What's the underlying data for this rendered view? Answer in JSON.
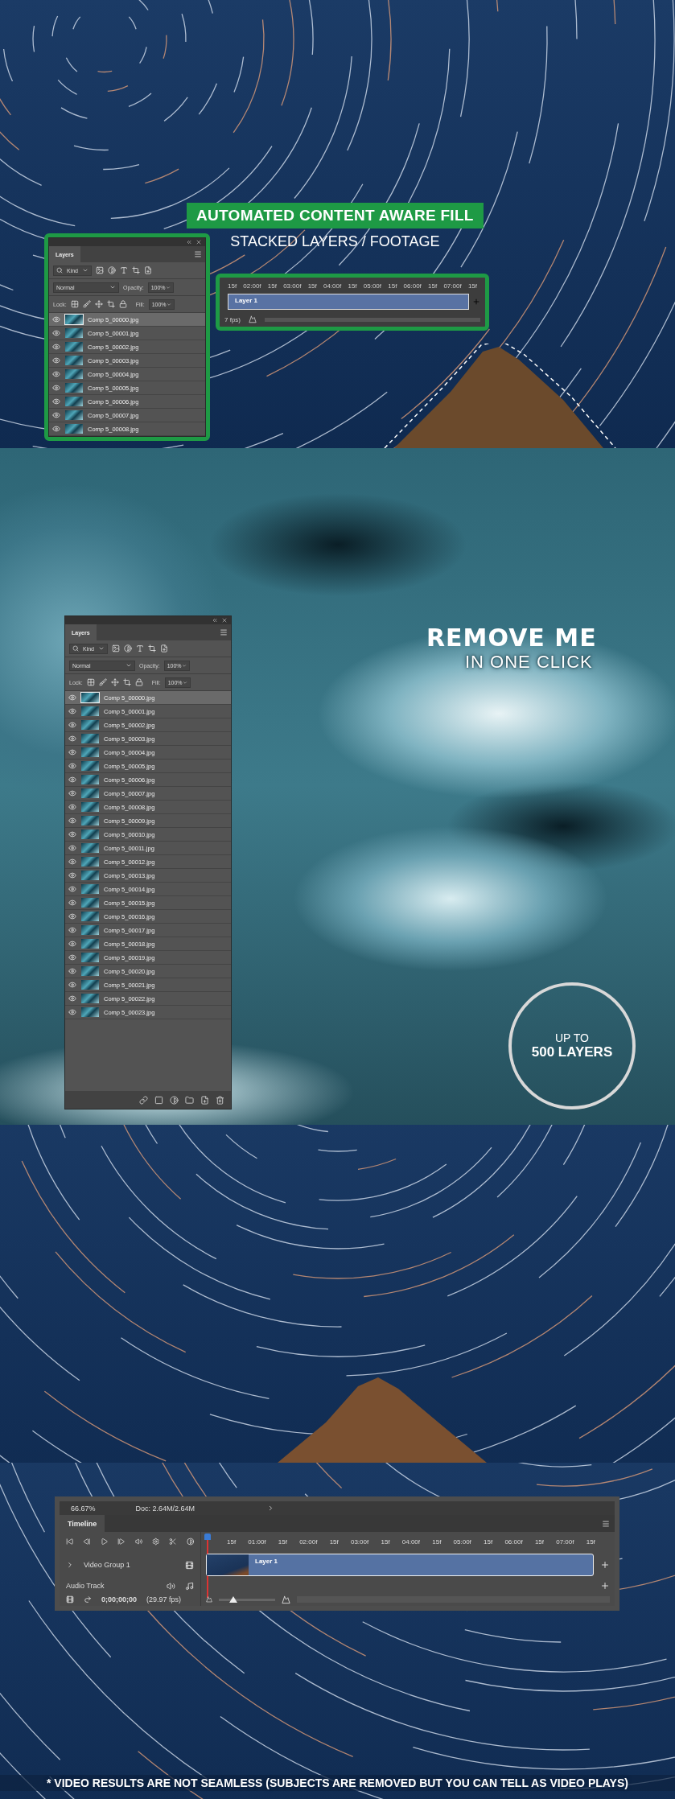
{
  "hero": {
    "banner": "AUTOMATED CONTENT AWARE FILL",
    "subtitle": "STACKED LAYERS / FOOTAGE",
    "mini_layers_panel": {
      "tab": "Layers",
      "filter": "Kind",
      "blend_mode": "Normal",
      "opacity_label": "Opacity:",
      "opacity": "100%",
      "lock_label": "Lock:",
      "fill_label": "Fill:",
      "fill": "100%",
      "layers": [
        {
          "name": "Comp 5_00000.jpg",
          "selected": true
        },
        {
          "name": "Comp 5_00001.jpg",
          "selected": false
        },
        {
          "name": "Comp 5_00002.jpg",
          "selected": false
        },
        {
          "name": "Comp 5_00003.jpg",
          "selected": false
        },
        {
          "name": "Comp 5_00004.jpg",
          "selected": false
        },
        {
          "name": "Comp 5_00005.jpg",
          "selected": false
        },
        {
          "name": "Comp 5_00006.jpg",
          "selected": false
        },
        {
          "name": "Comp 5_00007.jpg",
          "selected": false
        },
        {
          "name": "Comp 5_00008.jpg",
          "selected": false
        }
      ]
    },
    "mini_timeline": {
      "ruler": [
        "15f",
        "02:00f",
        "15f",
        "03:00f",
        "15f",
        "04:00f",
        "15f",
        "05:00f",
        "15f",
        "06:00f",
        "15f",
        "07:00f",
        "15f"
      ],
      "clip": "Layer 1",
      "frame_rate": "7 fps)"
    }
  },
  "feature": {
    "headline": "REMOVE ME",
    "tagline": "IN ONE CLICK",
    "layers_panel": {
      "tab": "Layers",
      "filter": "Kind",
      "blend_mode": "Normal",
      "opacity_label": "Opacity:",
      "opacity": "100%",
      "lock_label": "Lock:",
      "fill_label": "Fill:",
      "fill": "100%",
      "layers": [
        {
          "name": "Comp 5_00000.jpg",
          "selected": true
        },
        {
          "name": "Comp 5_00001.jpg",
          "selected": false
        },
        {
          "name": "Comp 5_00002.jpg",
          "selected": false
        },
        {
          "name": "Comp 5_00003.jpg",
          "selected": false
        },
        {
          "name": "Comp 5_00004.jpg",
          "selected": false
        },
        {
          "name": "Comp 5_00005.jpg",
          "selected": false
        },
        {
          "name": "Comp 5_00006.jpg",
          "selected": false
        },
        {
          "name": "Comp 5_00007.jpg",
          "selected": false
        },
        {
          "name": "Comp 5_00008.jpg",
          "selected": false
        },
        {
          "name": "Comp 5_00009.jpg",
          "selected": false
        },
        {
          "name": "Comp 5_00010.jpg",
          "selected": false
        },
        {
          "name": "Comp 5_00011.jpg",
          "selected": false
        },
        {
          "name": "Comp 5_00012.jpg",
          "selected": false
        },
        {
          "name": "Comp 5_00013.jpg",
          "selected": false
        },
        {
          "name": "Comp 5_00014.jpg",
          "selected": false
        },
        {
          "name": "Comp 5_00015.jpg",
          "selected": false
        },
        {
          "name": "Comp 5_00016.jpg",
          "selected": false
        },
        {
          "name": "Comp 5_00017.jpg",
          "selected": false
        },
        {
          "name": "Comp 5_00018.jpg",
          "selected": false
        },
        {
          "name": "Comp 5_00019.jpg",
          "selected": false
        },
        {
          "name": "Comp 5_00020.jpg",
          "selected": false
        },
        {
          "name": "Comp 5_00021.jpg",
          "selected": false
        },
        {
          "name": "Comp 5_00022.jpg",
          "selected": false
        },
        {
          "name": "Comp 5_00023.jpg",
          "selected": false
        }
      ]
    },
    "badge": {
      "line_1": "UP TO",
      "line_2": "500 LAYERS"
    }
  },
  "timeline_panel": {
    "zoom": "66.67%",
    "doc": "Doc: 2.64M/2.64M",
    "tab": "Timeline",
    "ruler": [
      "15f",
      "01:00f",
      "15f",
      "02:00f",
      "15f",
      "03:00f",
      "15f",
      "04:00f",
      "15f",
      "05:00f",
      "15f",
      "06:00f",
      "15f",
      "07:00f",
      "15f"
    ],
    "tracks": [
      {
        "kind": "video",
        "name": "Video Group 1",
        "clip": "Layer 1"
      },
      {
        "kind": "audio",
        "name": "Audio Track"
      }
    ],
    "timecode": "0;00;00;00",
    "frame_rate": "(29.97 fps)",
    "zoom_slider": {
      "level": 0.25
    }
  },
  "footnote": "* VIDEO RESULTS ARE NOT SEAMLESS (SUBJECTS ARE REMOVED BUT YOU CAN TELL AS VIDEO PLAYS)"
}
